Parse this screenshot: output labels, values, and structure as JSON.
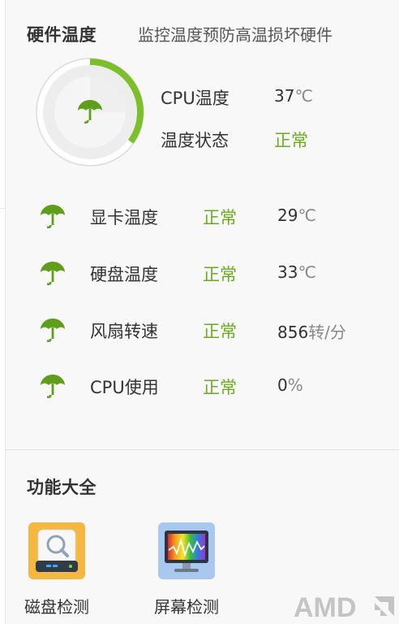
{
  "hardware": {
    "title": "硬件温度",
    "description": "监控温度预防高温损坏硬件",
    "cpu_temp_label": "CPU温度",
    "cpu_temp_value": "37",
    "cpu_temp_unit": "℃",
    "temp_status_label": "温度状态",
    "temp_status_value": "正常",
    "gauge_level": 0.35,
    "rows": [
      {
        "label": "显卡温度",
        "status": "正常",
        "value": "29",
        "unit": "℃",
        "icon": "umbrella-icon"
      },
      {
        "label": "硬盘温度",
        "status": "正常",
        "value": "33",
        "unit": "℃",
        "icon": "umbrella-icon"
      },
      {
        "label": "风扇转速",
        "status": "正常",
        "value": "856",
        "unit": "转/分",
        "icon": "umbrella-icon"
      },
      {
        "label": "CPU使用",
        "status": "正常",
        "value": "0",
        "unit": "%",
        "icon": "umbrella-icon"
      }
    ]
  },
  "functions": {
    "title": "功能大全",
    "tools": [
      {
        "label": "磁盘检测",
        "icon": "disk-scan-icon"
      },
      {
        "label": "屏幕检测",
        "icon": "monitor-test-icon"
      }
    ]
  },
  "brand": {
    "logo_text": "AMD"
  },
  "colors": {
    "accent_green": "#6aaa1e",
    "status_green": "#6aaa1e",
    "disk_orange": "#f4b840",
    "monitor_blue": "#a9c8f0"
  }
}
